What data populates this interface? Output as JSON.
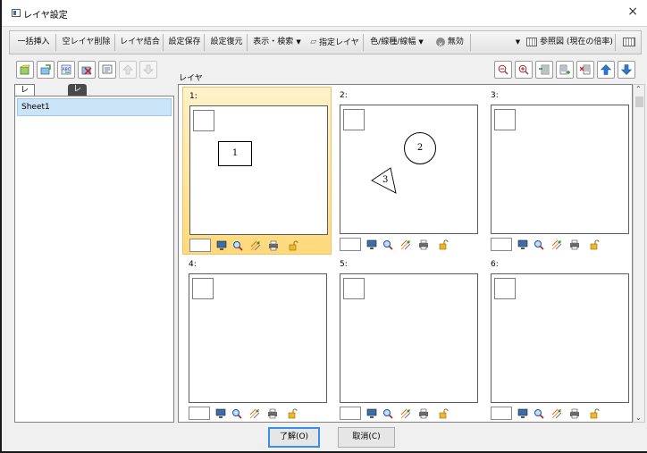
{
  "window": {
    "title": "レイヤ設定",
    "close_glyph": "×"
  },
  "toolbar": {
    "bulk_insert": "一括挿入",
    "delete_empty": "空レイヤ削除",
    "merge": "レイヤ結合",
    "save_settings": "設定保存",
    "restore_settings": "設定復元",
    "display_search": "表示・検索",
    "specified_layer": "指定レイヤ",
    "color_linetype": "色/線種/線幅",
    "disabled": "無効",
    "reference_view": "参照図 (現在の倍率)",
    "dropdown_glyph": "▼"
  },
  "panel": {
    "layer_label": "レイヤ",
    "tabs": [
      "レイヤシート",
      "レイアウト"
    ],
    "sheets": [
      "Sheet1"
    ]
  },
  "layers": [
    {
      "num": "1:",
      "selected": true,
      "shape": "1"
    },
    {
      "num": "2:",
      "selected": false,
      "shape_circle": "2",
      "shape_triangle": "3"
    },
    {
      "num": "3:",
      "selected": false
    },
    {
      "num": "4:",
      "selected": false
    },
    {
      "num": "5:",
      "selected": false
    },
    {
      "num": "6:",
      "selected": false
    }
  ],
  "buttons": {
    "ok": "了解(O)",
    "cancel": "取消(C)"
  },
  "colors": {
    "selected_bg": "#ffe49b",
    "selection_blue": "#cce4f7",
    "accent": "#3a8ee6"
  }
}
